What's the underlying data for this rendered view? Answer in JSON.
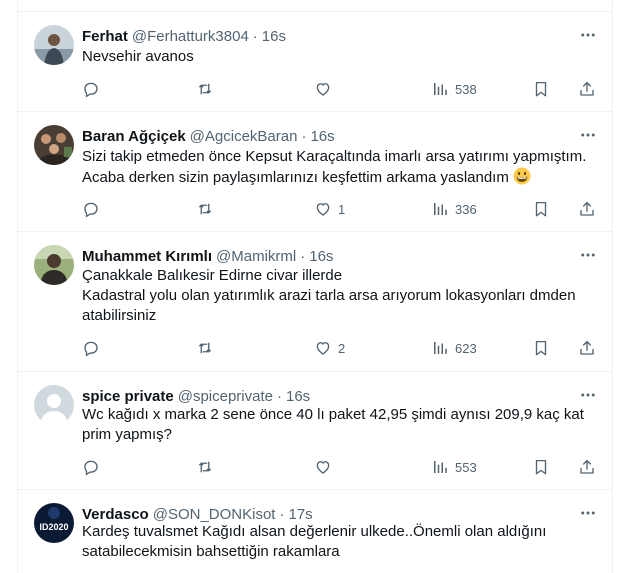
{
  "tweets": [
    {
      "name": "Ferhat",
      "handle": "@Ferhatturk3804",
      "dot": "·",
      "time": "16s",
      "text": "Nevsehir avanos",
      "replies": "",
      "retweets": "",
      "likes": "",
      "views": "538",
      "avatar": "photo-man"
    },
    {
      "name": "Baran Ağçiçek",
      "handle": "@AgcicekBaran",
      "dot": "·",
      "time": "16s",
      "text": "Sizi takip etmeden önce Kepsut Karaçaltında imarlı arsa yatırımı yapmıştım.\nAcaba derken sizin paylaşımlarınızı keşfettim arkama yaslandım",
      "emoji": "grinning-face",
      "replies": "",
      "retweets": "",
      "likes": "1",
      "views": "336",
      "avatar": "photo-group"
    },
    {
      "name": "Muhammet Kırımlı",
      "handle": "@Mamikrml",
      "dot": "·",
      "time": "16s",
      "text": "Çanakkale Balıkesir Edirne civar illerde\nKadastral yolu olan yatırımlık arazi tarla arsa arıyorum lokasyonları dmden\natabilirsiniz",
      "replies": "",
      "retweets": "",
      "likes": "2",
      "views": "623",
      "avatar": "photo-portrait"
    },
    {
      "name": "spice private",
      "handle": "@spiceprivate",
      "dot": "·",
      "time": "16s",
      "text": "Wc kağıdı x marka 2 sene önce 40 lı paket 42,95 şimdi aynısı 209,9 kaç kat\nprim yapmış?",
      "replies": "",
      "retweets": "",
      "likes": "",
      "views": "553",
      "avatar": "default-avatar"
    },
    {
      "name": "Verdasco",
      "handle": "@SON_DONKisot",
      "dot": "·",
      "time": "17s",
      "text": "Kardeş tuvalsmet Kağıdı alsan değerlenir ulkede..Önemli olan aldığını\nsatabilecekmisin bahsettiğin rakamlara",
      "avatar_text": "ID2020",
      "avatar": "logo-dark"
    }
  ],
  "colors": {
    "text": "#0f1419",
    "secondary": "#536471",
    "divider": "#eff3f4"
  }
}
